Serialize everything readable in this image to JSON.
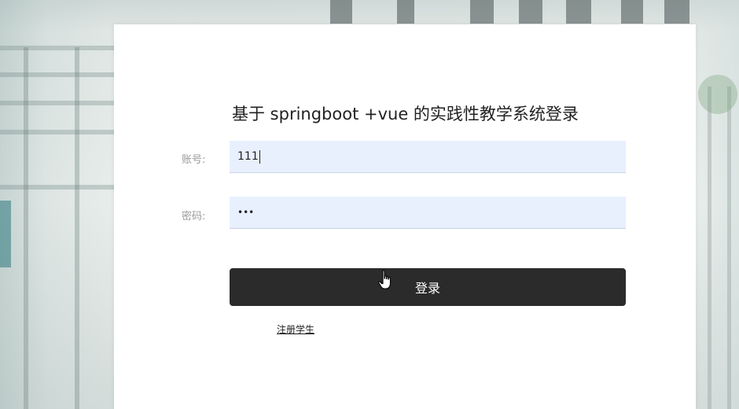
{
  "login": {
    "title": "基于 springboot +vue 的实践性教学系统登录",
    "account_label": "账号:",
    "account_value": "111",
    "password_label": "密码:",
    "password_value": "•••",
    "submit_label": "登录",
    "register_link": "注册学生"
  },
  "colors": {
    "input_bg": "#e8f0fe",
    "button_bg": "#2b2b2b",
    "card_bg": "#ffffff"
  },
  "icons": {
    "cursor": "hand-pointer-icon"
  }
}
